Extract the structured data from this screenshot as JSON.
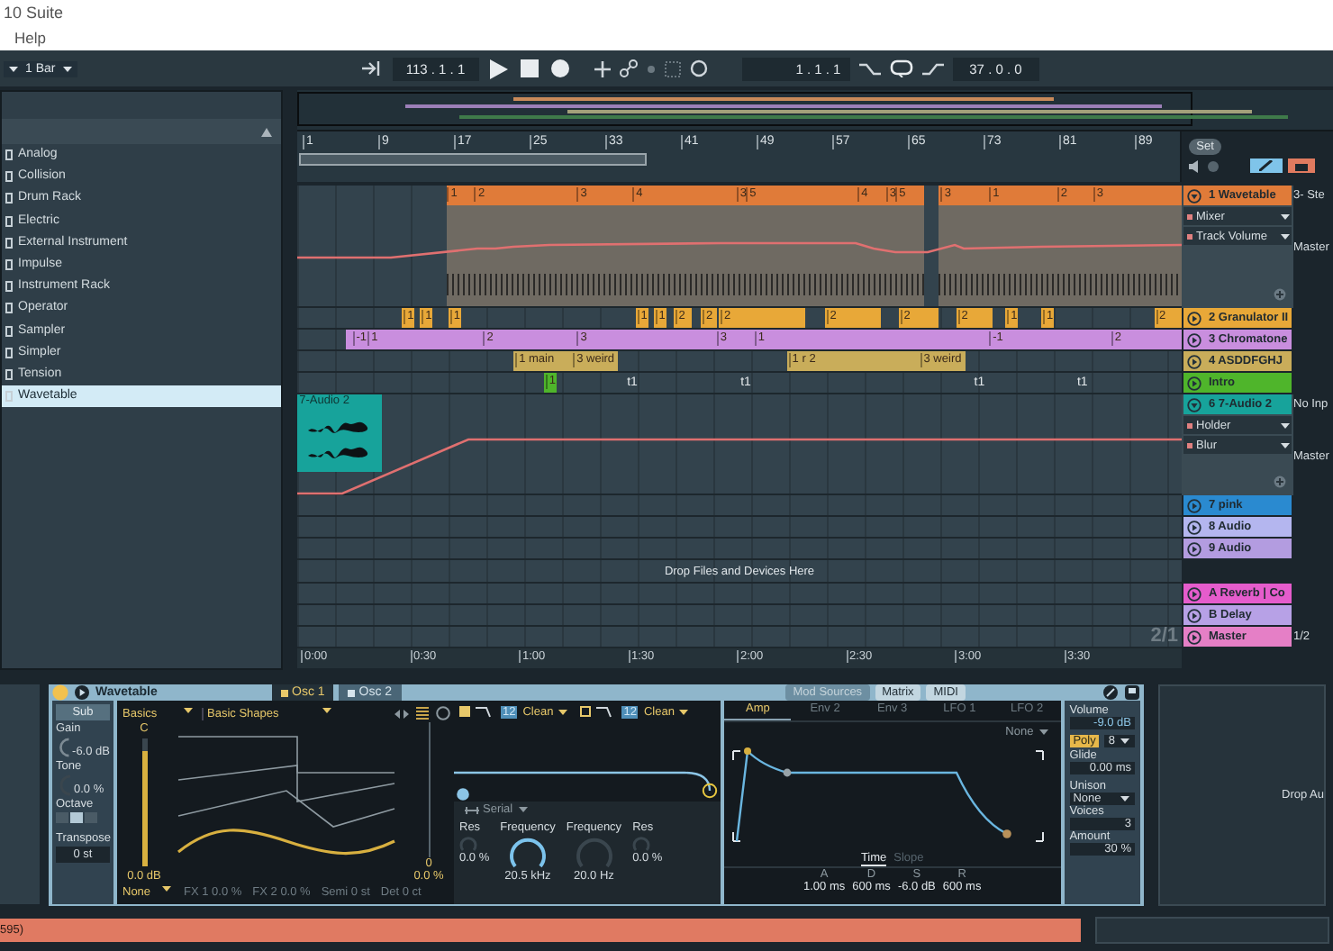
{
  "window": {
    "title": "10 Suite",
    "menu": [
      "Help"
    ]
  },
  "control_bar": {
    "quantization": "1 Bar",
    "arrangement_position": "113 . 1 . 1",
    "loop_start": "1 . 1 . 1",
    "loop_length": "37 . 0 . 0"
  },
  "browser": {
    "items": [
      {
        "label": "Analog",
        "selected": false
      },
      {
        "label": "Collision",
        "selected": false
      },
      {
        "label": "Drum Rack",
        "selected": false
      },
      {
        "label": "Electric",
        "selected": false
      },
      {
        "label": "External Instrument",
        "selected": false
      },
      {
        "label": "Impulse",
        "selected": false
      },
      {
        "label": "Instrument Rack",
        "selected": false
      },
      {
        "label": "Operator",
        "selected": false
      },
      {
        "label": "Sampler",
        "selected": false
      },
      {
        "label": "Simpler",
        "selected": false
      },
      {
        "label": "Tension",
        "selected": false
      },
      {
        "label": "Wavetable",
        "selected": true
      }
    ]
  },
  "arrangement": {
    "bar_ticks": [
      "1",
      "9",
      "17",
      "25",
      "33",
      "41",
      "49",
      "57",
      "65",
      "73",
      "81",
      "89"
    ],
    "set_button": "Set",
    "tracks": [
      {
        "name": "1 Wavetable",
        "color": "#e07b39",
        "expanded": true,
        "chains": [
          "Mixer",
          "Track Volume"
        ],
        "io": [
          "3- Ste",
          "Master"
        ],
        "clips": [
          {
            "marks": [
              "1",
              "2",
              "3",
              "4",
              "3",
              "5",
              "4",
              "3",
              "5"
            ]
          },
          {
            "marks": [
              "3",
              "1",
              "2",
              "3"
            ]
          }
        ]
      },
      {
        "name": "2 Granulator II",
        "color": "#e8a838",
        "expanded": false,
        "clips": [
          {
            "marks": [
              "1"
            ]
          },
          {
            "marks": [
              "1"
            ]
          },
          {
            "marks": [
              "1"
            ]
          },
          {
            "marks": [
              "1"
            ]
          },
          {
            "marks": [
              "1"
            ]
          },
          {
            "marks": [
              "2"
            ]
          },
          {
            "marks": [
              "2"
            ]
          },
          {
            "marks": [
              "2"
            ]
          },
          {
            "marks": [
              "2"
            ]
          },
          {
            "marks": [
              "2"
            ]
          },
          {
            "marks": [
              "2"
            ]
          },
          {
            "marks": [
              "1"
            ]
          },
          {
            "marks": [
              "1"
            ]
          },
          {
            "marks": [
              "2"
            ]
          }
        ]
      },
      {
        "name": "3 Chromatone",
        "color": "#c98ede",
        "expanded": false,
        "clips": [
          {
            "marks": [
              "-1",
              "1",
              "2",
              "3",
              "3",
              "1",
              "-1",
              "2"
            ]
          }
        ]
      },
      {
        "name": "4 ASDDFGHJ",
        "color": "#c9ad5a",
        "expanded": false,
        "clips": [
          {
            "marks": [
              "1 main"
            ]
          },
          {
            "marks": [
              "3 weird"
            ]
          },
          {
            "marks": [
              "1 r 2"
            ]
          },
          {
            "marks": [
              "3 weird"
            ]
          }
        ]
      },
      {
        "name": "Intro",
        "color": "#4fb52b",
        "expanded": false,
        "clips": [
          {
            "marks": [
              "1"
            ]
          }
        ],
        "lane_texts": [
          "t1",
          "t1",
          "t1",
          "t1"
        ]
      },
      {
        "name": "6 7-Audio 2",
        "color": "#17a39b",
        "expanded": true,
        "chains": [
          "Holder",
          "Blur"
        ],
        "io": [
          "No Inp",
          "Master"
        ],
        "clips": [
          {
            "title": "7-Audio 2"
          }
        ]
      },
      {
        "name": "7 pink",
        "color": "#2a8ad0",
        "expanded": false
      },
      {
        "name": "8 Audio",
        "color": "#b4b6ef",
        "expanded": false
      },
      {
        "name": "9 Audio",
        "color": "#b39ce0",
        "expanded": false
      }
    ],
    "drop_hint": "Drop Files and Devices Here",
    "returns": [
      {
        "name": "A Reverb | Co",
        "color": "#e55ccc",
        "expanded": false
      },
      {
        "name": "B Delay",
        "color": "#b7a1e6",
        "expanded": false
      },
      {
        "name": "Master",
        "color": "#e57fc6",
        "expanded": false,
        "io": [
          "1/2"
        ]
      }
    ],
    "page_indicator": "2/1",
    "time_ticks": [
      "0:00",
      "0:30",
      "1:00",
      "1:30",
      "2:00",
      "2:30",
      "3:00",
      "3:30"
    ]
  },
  "device": {
    "title": "Wavetable",
    "on": true,
    "tabs": [
      {
        "label": "Osc 1",
        "selected": true
      },
      {
        "label": "Osc 2",
        "selected": false
      }
    ],
    "osc": {
      "sub_button": "Sub",
      "gain_label": "Gain",
      "gain": "-6.0 dB",
      "tone_label": "Tone",
      "tone": "0.0 %",
      "octave_label": "Octave",
      "octave_buttons": [
        {
          "selected": false
        },
        {
          "selected": true
        },
        {
          "selected": false
        }
      ],
      "transpose_label": "Transpose",
      "transpose": "0 st",
      "category": "Basics",
      "wavetable": "Basic Shapes",
      "pitch": "C",
      "level_slider": {
        "level": 0.9
      },
      "level_value": "0.0 dB",
      "position_value": "0",
      "position_percent": "0.0 %",
      "fx_mode": "None",
      "fx1": "FX 1 0.0 %",
      "fx2": "FX 2 0.0 %",
      "semi": "Semi 0 st",
      "detune": "Det 0 ct"
    },
    "filters": [
      {
        "on": true,
        "slope": "12",
        "circuit": "Clean"
      },
      {
        "on": false,
        "slope": "12",
        "circuit": "Clean"
      }
    ],
    "routing": "Serial",
    "filter_knobs": [
      {
        "label": "Res",
        "value": "0.0 %"
      },
      {
        "label": "Frequency",
        "value": "20.5 kHz"
      },
      {
        "label": "Frequency",
        "value": "20.0 Hz"
      },
      {
        "label": "Res",
        "value": "0.0 %"
      }
    ],
    "mod": {
      "header_tabs": [
        {
          "label": "Mod Sources",
          "selected": true
        },
        {
          "label": "Matrix",
          "selected": false
        },
        {
          "label": "MIDI",
          "selected": false
        }
      ],
      "tabs": [
        {
          "label": "Amp",
          "selected": true
        },
        {
          "label": "Env 2",
          "selected": false
        },
        {
          "label": "Env 3",
          "selected": false
        },
        {
          "label": "LFO 1",
          "selected": false
        },
        {
          "label": "LFO 2",
          "selected": false
        }
      ],
      "target": "None",
      "view_tabs": [
        {
          "label": "Time",
          "selected": true
        },
        {
          "label": "Slope",
          "selected": false
        }
      ],
      "adsr": [
        {
          "label": "A",
          "value": "1.00 ms"
        },
        {
          "label": "D",
          "value": "600 ms"
        },
        {
          "label": "S",
          "value": "-6.0 dB"
        },
        {
          "label": "R",
          "value": "600 ms"
        }
      ]
    },
    "global": {
      "volume_label": "Volume",
      "volume": "-9.0 dB",
      "poly": "Poly",
      "poly_on": true,
      "voice_count": "8",
      "glide_label": "Glide",
      "glide": "0.00 ms",
      "unison_label": "Unison",
      "unison": "None",
      "voices_label": "Voices",
      "voices": "3",
      "amount_label": "Amount",
      "amount": "30 %"
    }
  },
  "drop_area": "Drop Au",
  "status_bar": {
    "text": "595)"
  }
}
